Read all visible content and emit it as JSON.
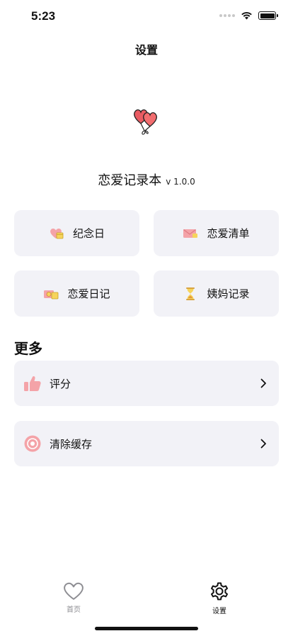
{
  "status_bar": {
    "time": "5:23"
  },
  "header": {
    "title": "设置"
  },
  "app": {
    "name": "恋爱记录本",
    "version": "v 1.0.0"
  },
  "features": [
    {
      "label": "纪念日",
      "icon": "heart-calendar-icon"
    },
    {
      "label": "恋爱清单",
      "icon": "love-letter-icon"
    },
    {
      "label": "恋爱日记",
      "icon": "photo-diary-icon"
    },
    {
      "label": "姨妈记录",
      "icon": "hourglass-icon"
    }
  ],
  "more": {
    "title": "更多",
    "items": [
      {
        "label": "评分",
        "icon": "thumbs-up-icon"
      },
      {
        "label": "清除缓存",
        "icon": "clear-cache-icon"
      }
    ]
  },
  "tab_bar": {
    "tabs": [
      {
        "label": "首页",
        "icon": "heart-outline-icon",
        "active": false
      },
      {
        "label": "设置",
        "icon": "gear-icon",
        "active": true
      }
    ]
  },
  "colors": {
    "accent_pink": "#f4a3a8",
    "card_bg": "#f2f2f7",
    "inactive_tab": "#8e8e93"
  }
}
